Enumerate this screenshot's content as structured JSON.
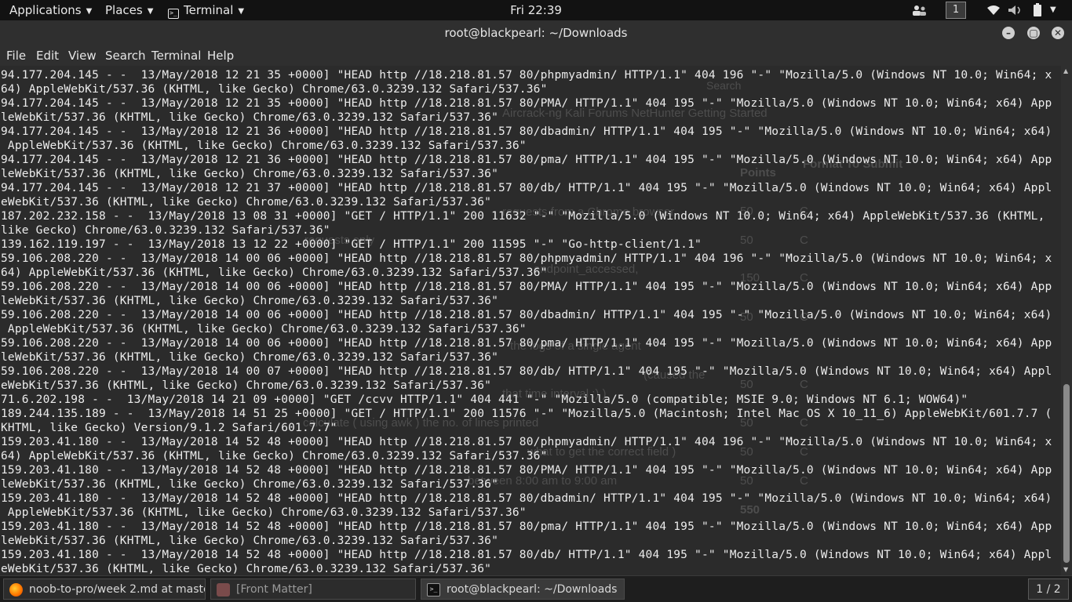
{
  "top_panel": {
    "applications_label": "Applications",
    "places_label": "Places",
    "terminal_label": "Terminal",
    "clock": "Fri 22:39",
    "workspace": "1"
  },
  "window": {
    "title": "root@blackpearl: ~/Downloads",
    "menu": [
      "File",
      "Edit",
      "View",
      "Search",
      "Terminal",
      "Help"
    ]
  },
  "background_ghost": {
    "browser_tabs": "Aircrack-ng  Kali Forums  NetHunter  Getting Started",
    "search_placeholder": "Search",
    "points_header": "Points",
    "format_header": "Format To Submit",
    "rows": [
      {
        "points": "50",
        "format": "C"
      },
      {
        "points": "50",
        "format": "C"
      },
      {
        "points": "150",
        "format": "C"
      },
      {
        "points": "50",
        "format": "C"
      },
      {
        "points": "50",
        "format": "C"
      },
      {
        "points": "50",
        "format": "C"
      },
      {
        "points": "50",
        "format": "C"
      },
      {
        "points": "50",
        "format": "C"
      }
    ],
    "total": "550",
    "snippets": [
      "requests from a Chrome browser",
      "requests only",
      "endpoint_accessed,",
      "the logs of a single agent",
      "(caused the",
      "that time interval :) )",
      "calculate ( using awk ) the no. of lines printed",
      "what to get the correct field )",
      "between 8:00 am to 9:00 am"
    ]
  },
  "terminal_lines": [
    "94.177.204.145 - -  13/May/2018 12 21 35 +0000] \"HEAD http //18.218.81.57 80/phpmyadmin/ HTTP/1.1\" 404 196 \"-\" \"Mozilla/5.0 (Windows NT 10.0; Win64; x",
    "64) AppleWebKit/537.36 (KHTML, like Gecko) Chrome/63.0.3239.132 Safari/537.36\"",
    "94.177.204.145 - -  13/May/2018 12 21 35 +0000] \"HEAD http //18.218.81.57 80/PMA/ HTTP/1.1\" 404 195 \"-\" \"Mozilla/5.0 (Windows NT 10.0; Win64; x64) App",
    "leWebKit/537.36 (KHTML, like Gecko) Chrome/63.0.3239.132 Safari/537.36\"",
    "94.177.204.145 - -  13/May/2018 12 21 36 +0000] \"HEAD http //18.218.81.57 80/dbadmin/ HTTP/1.1\" 404 195 \"-\" \"Mozilla/5.0 (Windows NT 10.0; Win64; x64)",
    " AppleWebKit/537.36 (KHTML, like Gecko) Chrome/63.0.3239.132 Safari/537.36\"",
    "94.177.204.145 - -  13/May/2018 12 21 36 +0000] \"HEAD http //18.218.81.57 80/pma/ HTTP/1.1\" 404 195 \"-\" \"Mozilla/5.0 (Windows NT 10.0; Win64; x64) App",
    "leWebKit/537.36 (KHTML, like Gecko) Chrome/63.0.3239.132 Safari/537.36\"",
    "94.177.204.145 - -  13/May/2018 12 21 37 +0000] \"HEAD http //18.218.81.57 80/db/ HTTP/1.1\" 404 195 \"-\" \"Mozilla/5.0 (Windows NT 10.0; Win64; x64) Appl",
    "eWebKit/537.36 (KHTML, like Gecko) Chrome/63.0.3239.132 Safari/537.36\"",
    "187.202.232.158 - -  13/May/2018 13 08 31 +0000] \"GET / HTTP/1.1\" 200 11632 \"-\" \"Mozilla/5.0 (Windows NT 10.0; Win64; x64) AppleWebKit/537.36 (KHTML,",
    "like Gecko) Chrome/63.0.3239.132 Safari/537.36\"",
    "139.162.119.197 - -  13/May/2018 13 12 22 +0000] \"GET / HTTP/1.1\" 200 11595 \"-\" \"Go-http-client/1.1\"",
    "59.106.208.220 - -  13/May/2018 14 00 06 +0000] \"HEAD http //18.218.81.57 80/phpmyadmin/ HTTP/1.1\" 404 196 \"-\" \"Mozilla/5.0 (Windows NT 10.0; Win64; x",
    "64) AppleWebKit/537.36 (KHTML, like Gecko) Chrome/63.0.3239.132 Safari/537.36\"",
    "59.106.208.220 - -  13/May/2018 14 00 06 +0000] \"HEAD http //18.218.81.57 80/PMA/ HTTP/1.1\" 404 195 \"-\" \"Mozilla/5.0 (Windows NT 10.0; Win64; x64) App",
    "leWebKit/537.36 (KHTML, like Gecko) Chrome/63.0.3239.132 Safari/537.36\"",
    "59.106.208.220 - -  13/May/2018 14 00 06 +0000] \"HEAD http //18.218.81.57 80/dbadmin/ HTTP/1.1\" 404 195 \"-\" \"Mozilla/5.0 (Windows NT 10.0; Win64; x64)",
    " AppleWebKit/537.36 (KHTML, like Gecko) Chrome/63.0.3239.132 Safari/537.36\"",
    "59.106.208.220 - -  13/May/2018 14 00 06 +0000] \"HEAD http //18.218.81.57 80/pma/ HTTP/1.1\" 404 195 \"-\" \"Mozilla/5.0 (Windows NT 10.0; Win64; x64) App",
    "leWebKit/537.36 (KHTML, like Gecko) Chrome/63.0.3239.132 Safari/537.36\"",
    "59.106.208.220 - -  13/May/2018 14 00 07 +0000] \"HEAD http //18.218.81.57 80/db/ HTTP/1.1\" 404 195 \"-\" \"Mozilla/5.0 (Windows NT 10.0; Win64; x64) Appl",
    "eWebKit/537.36 (KHTML, like Gecko) Chrome/63.0.3239.132 Safari/537.36\"",
    "71.6.202.198 - -  13/May/2018 14 21 09 +0000] \"GET /ccvv HTTP/1.1\" 404 441 \"-\" \"Mozilla/5.0 (compatible; MSIE 9.0; Windows NT 6.1; WOW64)\"",
    "189.244.135.189 - -  13/May/2018 14 51 25 +0000] \"GET / HTTP/1.1\" 200 11576 \"-\" \"Mozilla/5.0 (Macintosh; Intel Mac OS X 10_11_6) AppleWebKit/601.7.7 (",
    "KHTML, like Gecko) Version/9.1.2 Safari/601.7.7\"",
    "159.203.41.180 - -  13/May/2018 14 52 48 +0000] \"HEAD http //18.218.81.57 80/phpmyadmin/ HTTP/1.1\" 404 196 \"-\" \"Mozilla/5.0 (Windows NT 10.0; Win64; x",
    "64) AppleWebKit/537.36 (KHTML, like Gecko) Chrome/63.0.3239.132 Safari/537.36\"",
    "159.203.41.180 - -  13/May/2018 14 52 48 +0000] \"HEAD http //18.218.81.57 80/PMA/ HTTP/1.1\" 404 195 \"-\" \"Mozilla/5.0 (Windows NT 10.0; Win64; x64) App",
    "leWebKit/537.36 (KHTML, like Gecko) Chrome/63.0.3239.132 Safari/537.36\"",
    "159.203.41.180 - -  13/May/2018 14 52 48 +0000] \"HEAD http //18.218.81.57 80/dbadmin/ HTTP/1.1\" 404 195 \"-\" \"Mozilla/5.0 (Windows NT 10.0; Win64; x64)",
    " AppleWebKit/537.36 (KHTML, like Gecko) Chrome/63.0.3239.132 Safari/537.36\"",
    "159.203.41.180 - -  13/May/2018 14 52 48 +0000] \"HEAD http //18.218.81.57 80/pma/ HTTP/1.1\" 404 195 \"-\" \"Mozilla/5.0 (Windows NT 10.0; Win64; x64) App",
    "leWebKit/537.36 (KHTML, like Gecko) Chrome/63.0.3239.132 Safari/537.36\"",
    "159.203.41.180 - -  13/May/2018 14 52 48 +0000] \"HEAD http //18.218.81.57 80/db/ HTTP/1.1\" 404 195 \"-\" \"Mozilla/5.0 (Windows NT 10.0; Win64; x64) Appl",
    "eWebKit/537.36 (KHTML, like Gecko) Chrome/63.0.3239.132 Safari/537.36\""
  ],
  "taskbar": {
    "items": [
      {
        "label": "noob-to-pro/week 2.md at master..."
      },
      {
        "label": "[Front Matter]"
      },
      {
        "label": "root@blackpearl: ~/Downloads"
      }
    ],
    "pager": "1 / 2"
  },
  "icons": {
    "tray": [
      "users-icon",
      "wifi-icon",
      "volume-icon",
      "battery-icon"
    ]
  },
  "colors": {
    "terminal_bg": "#2b2b2b",
    "terminal_fg": "#ececec",
    "panel_bg": "#121212"
  }
}
